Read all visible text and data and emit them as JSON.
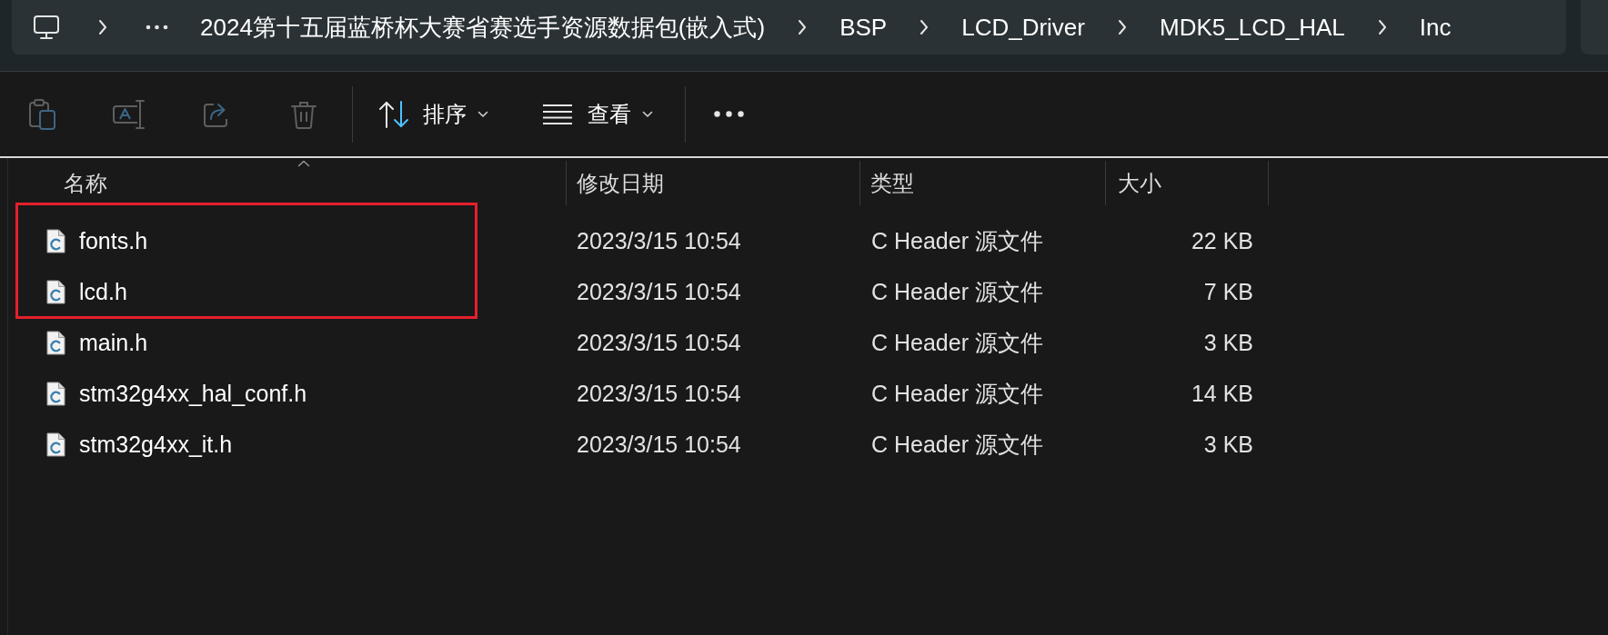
{
  "breadcrumb": {
    "segments": [
      "2024第十五届蓝桥杯大赛省赛选手资源数据包(嵌入式)",
      "BSP",
      "LCD_Driver",
      "MDK5_LCD_HAL",
      "Inc"
    ]
  },
  "toolbar": {
    "groups": [
      {
        "buttons": [
          {
            "kind": "paste",
            "disabled": true
          },
          {
            "kind": "rename",
            "disabled": true
          },
          {
            "kind": "share",
            "disabled": true
          },
          {
            "kind": "delete",
            "disabled": true
          }
        ]
      },
      {
        "buttons": [
          {
            "kind": "sort",
            "label": "排序",
            "disabled": false
          },
          {
            "kind": "view",
            "label": "查看",
            "disabled": false
          }
        ]
      },
      {
        "buttons": [
          {
            "kind": "more",
            "disabled": false
          }
        ]
      }
    ]
  },
  "file_list": {
    "columns": [
      {
        "label": "名称",
        "sorted": true
      },
      {
        "label": "修改日期",
        "sorted": false
      },
      {
        "label": "类型",
        "sorted": false
      },
      {
        "label": "大小",
        "sorted": false
      }
    ],
    "rows": [
      {
        "name": "fonts.h",
        "modified": "2023/3/15 10:54",
        "type": "C Header 源文件",
        "size": "22 KB",
        "annotated": true
      },
      {
        "name": "lcd.h",
        "modified": "2023/3/15 10:54",
        "type": "C Header 源文件",
        "size": "7 KB",
        "annotated": true
      },
      {
        "name": "main.h",
        "modified": "2023/3/15 10:54",
        "type": "C Header 源文件",
        "size": "3 KB",
        "annotated": false
      },
      {
        "name": "stm32g4xx_hal_conf.h",
        "modified": "2023/3/15 10:54",
        "type": "C Header 源文件",
        "size": "14 KB",
        "annotated": false
      },
      {
        "name": "stm32g4xx_it.h",
        "modified": "2023/3/15 10:54",
        "type": "C Header 源文件",
        "size": "3 KB",
        "annotated": false
      }
    ]
  }
}
